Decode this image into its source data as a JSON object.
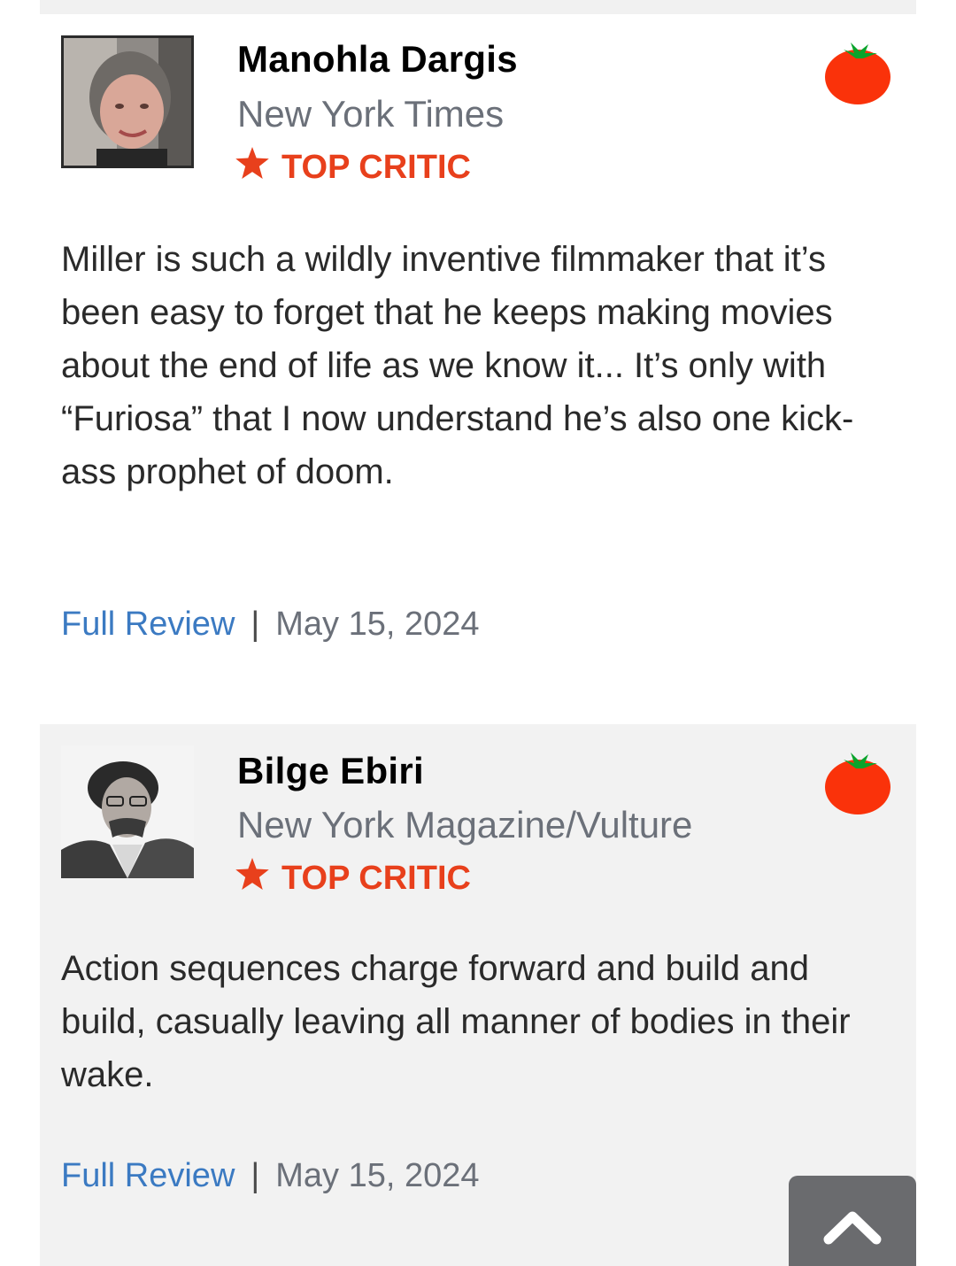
{
  "reviews": [
    {
      "critic_name": "Manohla Dargis",
      "publication": "New York Times",
      "badge": "TOP CRITIC",
      "quote": "Miller is such a wildly inventive filmmaker that it’s been easy to forget that he keeps making movies about the end of life as we know it... It’s only with “Furiosa” that I now understand he’s also one kick-ass prophet of doom.",
      "link_label": "Full Review",
      "separator": "|",
      "date": "May 15, 2024",
      "score_icon": "fresh-tomato-icon"
    },
    {
      "critic_name": "Bilge Ebiri",
      "publication": "New York Magazine/Vulture",
      "badge": "TOP CRITIC",
      "quote": "Action sequences charge forward and build and build, casually leaving all manner of bodies in their wake.",
      "link_label": "Full Review",
      "separator": "|",
      "date": "May 15, 2024",
      "score_icon": "fresh-tomato-icon"
    }
  ],
  "colors": {
    "accent_red": "#e8401c",
    "link_blue": "#3b7ac2",
    "muted_gray": "#6b7079",
    "card_alt_bg": "#f2f2f2",
    "scroll_button_bg": "#6a6b6e"
  },
  "scroll_top_icon": "chevron-up-icon"
}
